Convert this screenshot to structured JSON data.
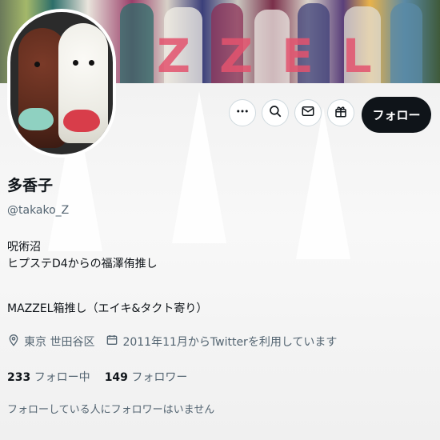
{
  "profile": {
    "name": "多香子",
    "handle": "@takako_Z",
    "bio_lines": [
      "呪術沼",
      "ヒプステD4からの福澤侑推し"
    ],
    "bio_extra": "MAZZEL箱推し（エイキ&タクト寄り）",
    "location": "東京 世田谷区",
    "joined": "2011年11月からTwitterを利用しています",
    "following_count": "233",
    "following_label": "フォロー中",
    "followers_count": "149",
    "followers_label": "フォロワー",
    "mutual_note": "フォローしている人にフォロワーはいません"
  },
  "banner": {
    "letters": [
      "Z",
      "Z",
      "E",
      "L"
    ]
  },
  "actions": {
    "more_icon": "more-icon",
    "search_icon": "search-icon",
    "message_icon": "mail-icon",
    "gift_icon": "gift-icon",
    "follow_label": "フォロー"
  },
  "colors": {
    "primary_button": "#0f1419",
    "muted_text": "#536471",
    "banner_accent": "#e3536e"
  }
}
